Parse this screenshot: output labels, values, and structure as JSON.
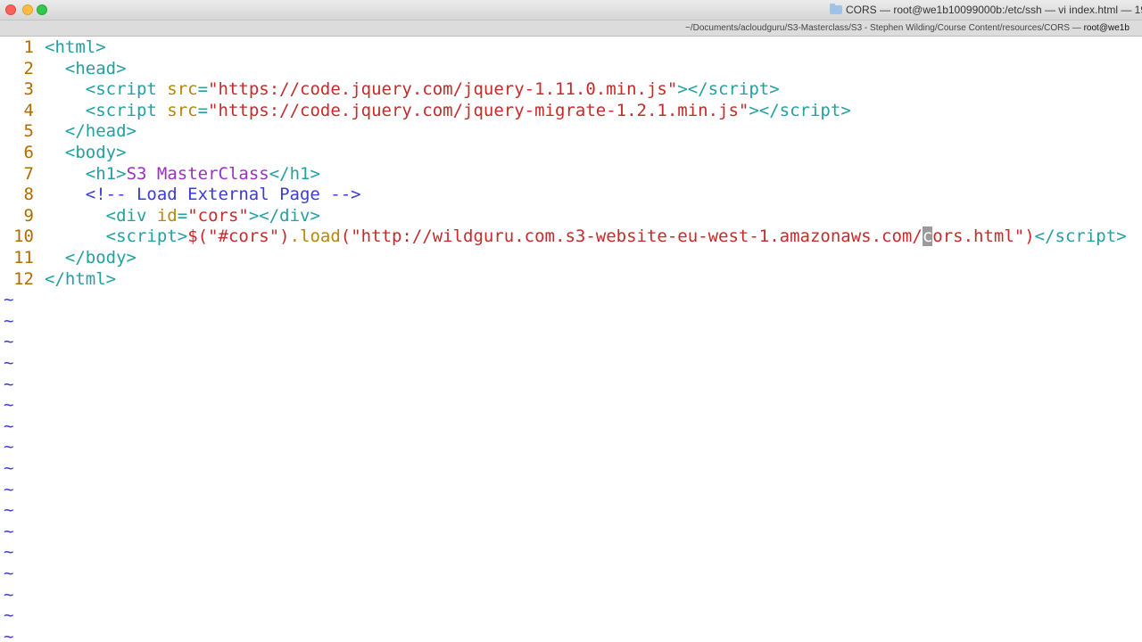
{
  "window": {
    "title": "CORS — root@we1b10099000b:/etc/ssh — vi index.html — 19",
    "tab_path": "~/Documents/acloudguru/S3-Masterclass/S3 - Stephen Wilding/Course Content/resources/CORS",
    "tab_sep": " — ",
    "tab_host": "root@we1b"
  },
  "editor": {
    "lines": [
      {
        "num": "1",
        "indent": "",
        "parts": [
          {
            "t": "<",
            "c": "tag"
          },
          {
            "t": "html",
            "c": "tagname"
          },
          {
            "t": ">",
            "c": "tag"
          }
        ]
      },
      {
        "num": "2",
        "indent": "  ",
        "parts": [
          {
            "t": "<",
            "c": "tag"
          },
          {
            "t": "head",
            "c": "tagname"
          },
          {
            "t": ">",
            "c": "tag"
          }
        ]
      },
      {
        "num": "3",
        "indent": "    ",
        "parts": [
          {
            "t": "<",
            "c": "tag"
          },
          {
            "t": "script",
            "c": "tagname"
          },
          {
            "t": " src",
            "c": "attr"
          },
          {
            "t": "=",
            "c": "tag"
          },
          {
            "t": "\"https://code.jquery.com/jquery-1.11.0.min.js\"",
            "c": "str"
          },
          {
            "t": "></",
            "c": "tag"
          },
          {
            "t": "script",
            "c": "tagname"
          },
          {
            "t": ">",
            "c": "tag"
          }
        ]
      },
      {
        "num": "4",
        "indent": "    ",
        "parts": [
          {
            "t": "<",
            "c": "tag"
          },
          {
            "t": "script",
            "c": "tagname"
          },
          {
            "t": " src",
            "c": "attr"
          },
          {
            "t": "=",
            "c": "tag"
          },
          {
            "t": "\"https://code.jquery.com/jquery-migrate-1.2.1.min.js\"",
            "c": "str"
          },
          {
            "t": "></",
            "c": "tag"
          },
          {
            "t": "script",
            "c": "tagname"
          },
          {
            "t": ">",
            "c": "tag"
          }
        ]
      },
      {
        "num": "5",
        "indent": "  ",
        "parts": [
          {
            "t": "</",
            "c": "tag"
          },
          {
            "t": "head",
            "c": "tagname"
          },
          {
            "t": ">",
            "c": "tag"
          }
        ]
      },
      {
        "num": "6",
        "indent": "  ",
        "parts": [
          {
            "t": "<",
            "c": "tag"
          },
          {
            "t": "body",
            "c": "tagname"
          },
          {
            "t": ">",
            "c": "tag"
          }
        ]
      },
      {
        "num": "7",
        "indent": "    ",
        "parts": [
          {
            "t": "<",
            "c": "tag"
          },
          {
            "t": "h1",
            "c": "tagname"
          },
          {
            "t": ">",
            "c": "tag"
          },
          {
            "t": "S3 MasterClass",
            "c": "text"
          },
          {
            "t": "</",
            "c": "tag"
          },
          {
            "t": "h1",
            "c": "tagname"
          },
          {
            "t": ">",
            "c": "tag"
          }
        ]
      },
      {
        "num": "8",
        "indent": "    ",
        "parts": [
          {
            "t": "<!-- Load External Page -->",
            "c": "comment"
          }
        ]
      },
      {
        "num": "9",
        "indent": "      ",
        "parts": [
          {
            "t": "<",
            "c": "tag"
          },
          {
            "t": "div",
            "c": "tagname"
          },
          {
            "t": " id",
            "c": "attr"
          },
          {
            "t": "=",
            "c": "tag"
          },
          {
            "t": "\"cors\"",
            "c": "str"
          },
          {
            "t": "></",
            "c": "tag"
          },
          {
            "t": "div",
            "c": "tagname"
          },
          {
            "t": ">",
            "c": "tag"
          }
        ]
      },
      {
        "num": "10",
        "indent": "      ",
        "parts": [
          {
            "t": "<",
            "c": "tag"
          },
          {
            "t": "script",
            "c": "tagname"
          },
          {
            "t": ">",
            "c": "tag"
          },
          {
            "t": "$(\"#cors\")",
            "c": "js"
          },
          {
            "t": ".load",
            "c": "attr"
          },
          {
            "t": "(\"http://wildguru.com.s3-website-eu-west-1.amazonaws.com/",
            "c": "str"
          },
          {
            "t": "c",
            "c": "cursor"
          },
          {
            "t": "ors.html\")",
            "c": "str"
          },
          {
            "t": "</",
            "c": "tag"
          },
          {
            "t": "script",
            "c": "tagname"
          },
          {
            "t": ">",
            "c": "tag"
          }
        ]
      },
      {
        "num": "11",
        "indent": "  ",
        "parts": [
          {
            "t": "</",
            "c": "tag"
          },
          {
            "t": "body",
            "c": "tagname"
          },
          {
            "t": ">",
            "c": "tag"
          }
        ]
      },
      {
        "num": "12",
        "indent": "",
        "parts": [
          {
            "t": "</",
            "c": "tag"
          },
          {
            "t": "html",
            "c": "tagname"
          },
          {
            "t": ">",
            "c": "tag"
          }
        ]
      }
    ],
    "empty_marker": "~",
    "empty_count": 17
  }
}
